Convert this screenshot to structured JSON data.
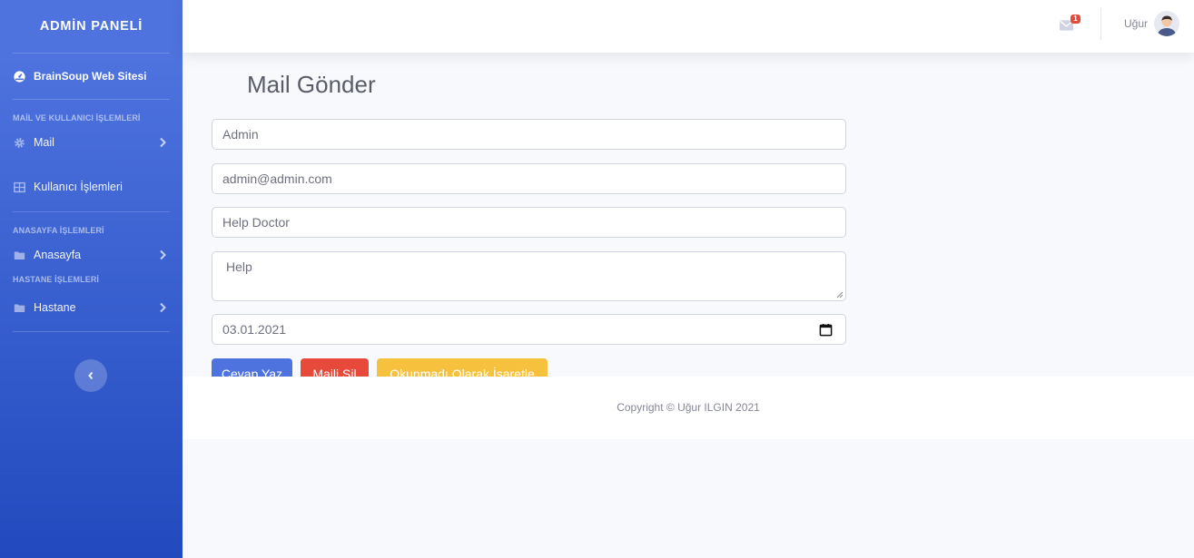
{
  "sidebar": {
    "brand": "ADMİN PANELİ",
    "site_link": "BrainSoup Web Sitesi",
    "sections": [
      {
        "heading": "MAİL VE KULLANICI İŞLEMLERİ"
      },
      {
        "heading": "ANASAYFA İŞLEMLERİ"
      },
      {
        "heading": "HASTANE İŞLEMLERİ"
      }
    ],
    "items": [
      {
        "label": "Mail",
        "icon": "gear-icon"
      },
      {
        "label": "Kullanıcı İşlemleri",
        "icon": "table-icon"
      },
      {
        "label": "Anasayfa",
        "icon": "folder-icon"
      },
      {
        "label": "Hastane",
        "icon": "folder-icon"
      }
    ]
  },
  "topbar": {
    "mail_badge": "1",
    "user_name": "Uğur"
  },
  "main": {
    "title": "Mail Gönder",
    "fields": {
      "name": "Admin",
      "email": "admin@admin.com",
      "subject": "Help Doctor",
      "message": "Help",
      "date": "03.01.2021"
    },
    "buttons": {
      "reply": "Cevap Yaz",
      "delete": "Maili Sil",
      "mark_unread": "Okunmadı Olarak İşaretle"
    }
  },
  "footer": {
    "copyright": "Copyright © Uğur ILGIN 2021"
  },
  "colors": {
    "primary": "#4e73df",
    "danger": "#e74a3b",
    "warning": "#f6c23e",
    "background": "#f8f9fc"
  }
}
